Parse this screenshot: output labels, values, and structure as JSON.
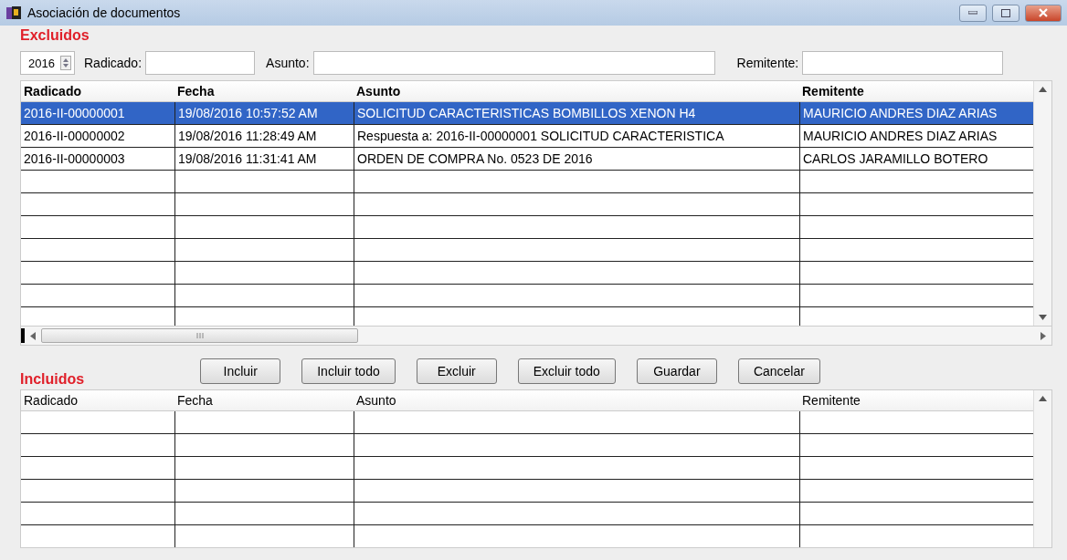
{
  "window": {
    "title": "Asociación de documentos"
  },
  "excluded": {
    "heading": "Excluidos",
    "filters": {
      "year": "2016",
      "radicado_label": "Radicado:",
      "asunto_label": "Asunto:",
      "remitente_label": "Remitente:"
    },
    "table": {
      "columns": [
        "Radicado",
        "Fecha",
        "Asunto",
        "Remitente"
      ],
      "rows": [
        {
          "cells": [
            "2016-II-00000001",
            "19/08/2016 10:57:52 AM",
            "SOLICITUD CARACTERISTICAS BOMBILLOS XENON H4",
            "MAURICIO ANDRES DIAZ ARIAS"
          ],
          "selected": true
        },
        {
          "cells": [
            "2016-II-00000002",
            "19/08/2016 11:28:49 AM",
            "Respuesta a: 2016-II-00000001 SOLICITUD CARACTERISTICA",
            "MAURICIO ANDRES DIAZ ARIAS"
          ],
          "selected": false
        },
        {
          "cells": [
            "2016-II-00000003",
            "19/08/2016 11:31:41 AM",
            "ORDEN DE COMPRA No. 0523 DE 2016",
            "CARLOS JARAMILLO BOTERO"
          ],
          "selected": false
        }
      ]
    }
  },
  "buttons": [
    "Incluir",
    "Incluir todo",
    "Excluir",
    "Excluir todo",
    "Guardar",
    "Cancelar"
  ],
  "included": {
    "heading": "Incluidos",
    "table": {
      "columns": [
        "Radicado",
        "Fecha",
        "Asunto",
        "Remitente"
      ]
    }
  }
}
